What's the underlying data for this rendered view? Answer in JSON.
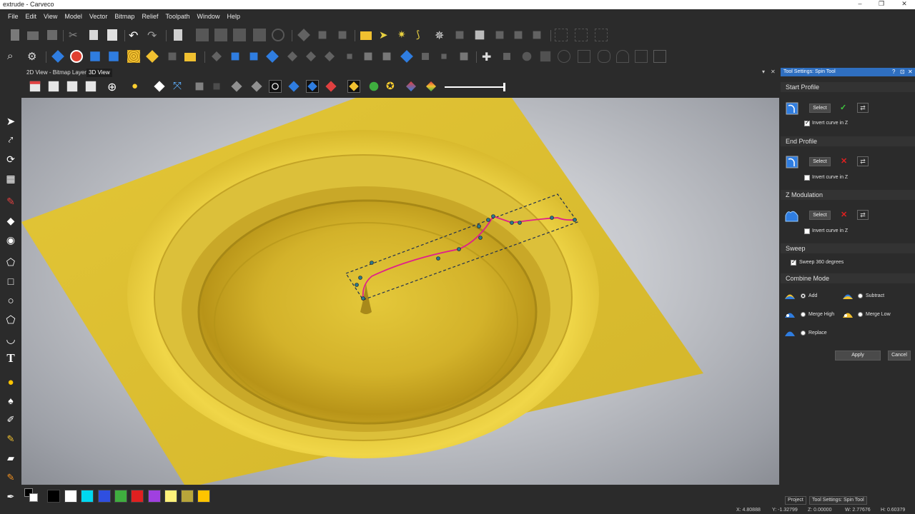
{
  "window": {
    "title": "extrude - Carveco",
    "controls": [
      "–",
      "❐",
      "✕"
    ]
  },
  "menu": [
    "File",
    "Edit",
    "View",
    "Model",
    "Vector",
    "Bitmap",
    "Relief",
    "Toolpath",
    "Window",
    "Help"
  ],
  "view_tabs": [
    {
      "label": "2D View - Bitmap Layer",
      "active": false
    },
    {
      "label": "3D View",
      "active": true
    }
  ],
  "panel": {
    "title": "Tool Settings: Spin Tool",
    "header_controls": [
      "?",
      "⊡",
      "✕"
    ],
    "start_profile": {
      "heading": "Start Profile",
      "select_label": "Select",
      "status": "✓",
      "swap": "⇄",
      "invert_label": "Invert curve in Z",
      "invert_checked": true
    },
    "end_profile": {
      "heading": "End Profile",
      "select_label": "Select",
      "status": "✕",
      "swap": "⇄",
      "invert_label": "Invert curve in Z",
      "invert_checked": false
    },
    "z_modulation": {
      "heading": "Z Modulation",
      "select_label": "Select",
      "status": "✕",
      "swap": "⇄",
      "invert_label": "Invert curve in Z",
      "invert_checked": false
    },
    "sweep": {
      "heading": "Sweep",
      "label": "Sweep 360 degrees",
      "checked": true
    },
    "combine_mode": {
      "heading": "Combine Mode",
      "options": [
        {
          "label": "Add",
          "selected": true
        },
        {
          "label": "Subtract",
          "selected": false
        },
        {
          "label": "Merge High",
          "selected": false
        },
        {
          "label": "Merge Low",
          "selected": false
        },
        {
          "label": "Replace",
          "selected": false
        }
      ]
    },
    "apply_label": "Apply",
    "cancel_label": "Cancel"
  },
  "bottom_tabs": [
    "Project",
    "Tool Settings: Spin Tool"
  ],
  "status": {
    "x": "X: 4.80888",
    "y": "Y: -1.32799",
    "z": "Z: 0.00000",
    "w": "W: 2.77676",
    "h": "H: 0.60379"
  },
  "palette": [
    "#000000",
    "#ffffff",
    "#00d8f0",
    "#2f4fe0",
    "#3fae3f",
    "#e02020",
    "#a040e0",
    "#fff27a",
    "#b8a53a",
    "#ffc400"
  ],
  "view_panel_controls": [
    "▾",
    "✕"
  ],
  "colors": {
    "accent": "#2f6fc0",
    "relief": "#e2c335",
    "vector": "#e0208a",
    "check_ok": "#3fc83f",
    "check_bad": "#e02020"
  }
}
